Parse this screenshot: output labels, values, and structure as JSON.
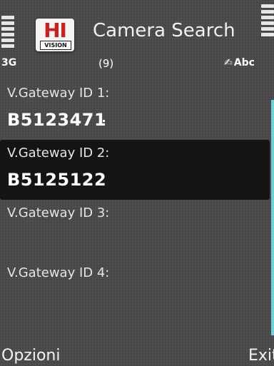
{
  "status": {
    "network": "3G",
    "text_input_mode": "Abc"
  },
  "header": {
    "title": "Camera Search",
    "counter": "(9)",
    "logo_text": "HI",
    "logo_subtext": "VISION"
  },
  "fields": [
    {
      "label": "V.Gateway ID 1:",
      "value": "B5123471"
    },
    {
      "label": "V.Gateway ID 2:",
      "value": "B5125122"
    },
    {
      "label": "V.Gateway ID 3:",
      "value": ""
    },
    {
      "label": "V.Gateway ID 4:",
      "value": ""
    }
  ],
  "softkeys": {
    "left": "Opzioni",
    "right": "Exit"
  },
  "colors": {
    "background": "#4a4a4a",
    "selected_row": "#141414",
    "scrollbar": "#6fd0d8",
    "logo_red": "#c82020"
  }
}
